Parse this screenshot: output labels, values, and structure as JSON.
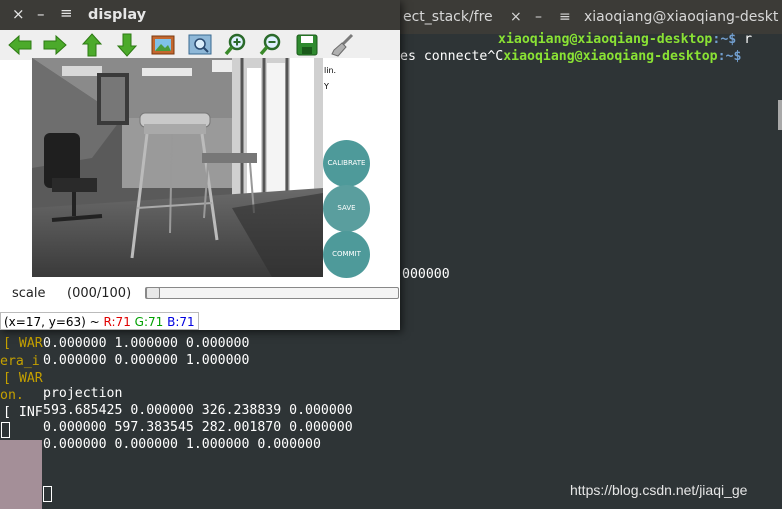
{
  "terminal": {
    "tabs": [
      {
        "label": "ect_stack/fre"
      },
      {
        "label": "xiaoqiang@xiaoqiang-deskt"
      }
    ],
    "prompt_user": "xiaoqiang@xiaoqiang-desktop",
    "prompt_path": ":~$",
    "prompt_cmd": "r",
    "line2_prefix": "es connecte^C",
    "line2_user": "xiaoqiang@xiaoqiang-desktop",
    "line2_path": ":~$",
    "zeros_tail": "000000",
    "left_fragments": [
      "[ WAR",
      "era_i",
      "[ WAR",
      "on.",
      "[ INF"
    ],
    "matrix_row2": "0.000000 1.000000 0.000000",
    "matrix_row3": "0.000000 0.000000 1.000000",
    "projection_label": "projection",
    "proj_row1": "593.685425 0.000000 326.238839 0.000000",
    "proj_row2": "0.000000 597.383545 282.001870 0.000000",
    "proj_row3": "0.000000 0.000000 1.000000 0.000000",
    "watermark": "https://blog.csdn.net/jiaqi_ge"
  },
  "display": {
    "title": "display",
    "close": "×",
    "minimize": "–",
    "menu": "≡",
    "buttons": {
      "calibrate": "CALIBRATE",
      "save": "SAVE",
      "commit": "COMMIT"
    },
    "side_x": "lin.",
    "side_y": "Y",
    "scale_label": "scale",
    "scale_value": "(000/100)",
    "scale_fraction": 0.0,
    "status_coords": "(x=17, y=63) ~",
    "status_r": "R:71",
    "status_g": "G:71",
    "status_b": "B:71"
  },
  "toolbar_icons": [
    "arrow-left-icon",
    "arrow-right-icon",
    "arrow-up-icon",
    "arrow-down-icon",
    "image-icon",
    "zoom-fit-icon",
    "zoom-in-icon",
    "zoom-out-icon",
    "save-icon",
    "brush-icon"
  ]
}
